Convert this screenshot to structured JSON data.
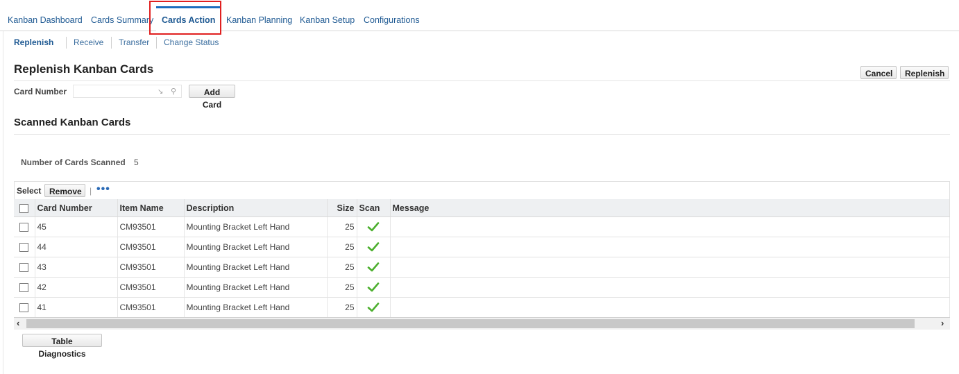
{
  "tabs": [
    {
      "label": "Kanban Dashboard"
    },
    {
      "label": "Cards Summary"
    },
    {
      "label": "Cards Action"
    },
    {
      "label": "Kanban Planning"
    },
    {
      "label": "Kanban Setup"
    },
    {
      "label": "Configurations"
    }
  ],
  "subnav": [
    {
      "label": "Replenish"
    },
    {
      "label": "Receive"
    },
    {
      "label": "Transfer"
    },
    {
      "label": "Change Status"
    }
  ],
  "page": {
    "title": "Replenish Kanban Cards",
    "cancel_label": "Cancel",
    "replenish_label": "Replenish"
  },
  "card_number": {
    "label": "Card Number",
    "value": "",
    "add_label": "Add Card"
  },
  "scanned": {
    "title": "Scanned Kanban Cards",
    "count_label": "Number of Cards Scanned",
    "count_value": "5"
  },
  "table": {
    "select_label": "Select",
    "remove_label": "Remove",
    "separator": "|",
    "more_label": "•••",
    "columns": [
      "Card Number",
      "Item Name",
      "Description",
      "Size",
      "Scan",
      "Message"
    ],
    "rows": [
      {
        "card": "45",
        "item": "CM93501",
        "desc": "Mounting Bracket Left Hand",
        "size": "25",
        "message": ""
      },
      {
        "card": "44",
        "item": "CM93501",
        "desc": "Mounting Bracket Left Hand",
        "size": "25",
        "message": ""
      },
      {
        "card": "43",
        "item": "CM93501",
        "desc": "Mounting Bracket Left Hand",
        "size": "25",
        "message": ""
      },
      {
        "card": "42",
        "item": "CM93501",
        "desc": "Mounting Bracket Left Hand",
        "size": "25",
        "message": ""
      },
      {
        "card": "41",
        "item": "CM93501",
        "desc": "Mounting Bracket Left Hand",
        "size": "25",
        "message": ""
      }
    ],
    "diagnostics_label": "Table Diagnostics"
  },
  "colors": {
    "link": "#1f5a93",
    "active_tab_bar": "#1b6dbd",
    "highlight": "#e02020",
    "check": "#4caf2e"
  },
  "icons": {
    "scan_status": "check-icon",
    "lov": "search-icon",
    "lov_arrow": "arrow-icon"
  }
}
